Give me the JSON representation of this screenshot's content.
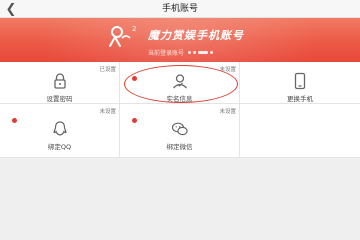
{
  "header": {
    "title": "手机账号",
    "back_icon": "back-arrow-icon"
  },
  "banner": {
    "brand_text": "魔力赏娱手机账号",
    "login_label": "当前登录账号",
    "colors": {
      "top": "#f07a63",
      "bottom": "#e8493a"
    }
  },
  "tiles": [
    {
      "label": "设置密码",
      "status": "已设置",
      "icon": "lock-icon",
      "red_dot": false
    },
    {
      "label": "实名信息",
      "status": "未设置",
      "icon": "user-icon",
      "red_dot": true
    },
    {
      "label": "更换手机",
      "status": "",
      "icon": "phone-icon",
      "red_dot": false
    },
    {
      "label": "绑定QQ",
      "status": "未设置",
      "icon": "qq-icon",
      "red_dot": true
    },
    {
      "label": "绑定微信",
      "status": "未设置",
      "icon": "wechat-icon",
      "red_dot": true
    }
  ],
  "accent_color": "#e53935"
}
